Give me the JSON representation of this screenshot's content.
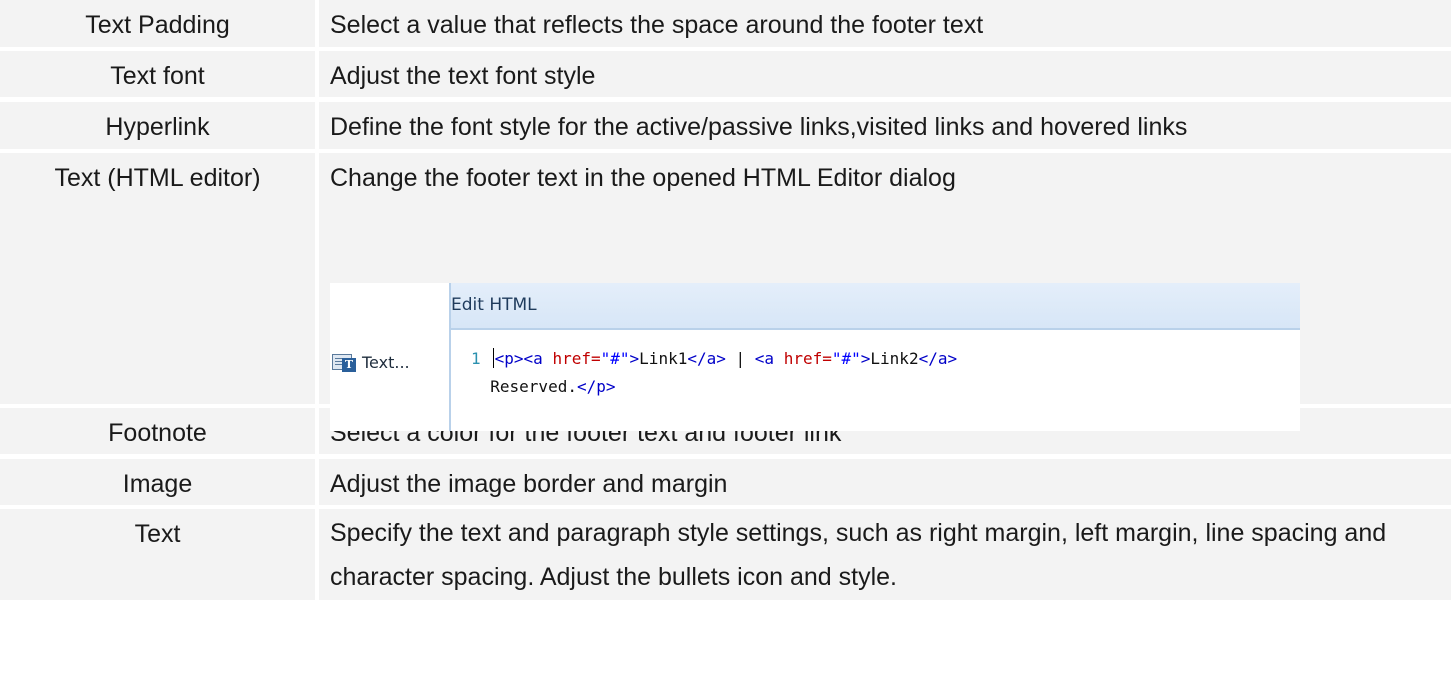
{
  "rows": [
    {
      "name": "Text Padding",
      "description": "Select a value that reflects the space around the footer text"
    },
    {
      "name": "Text font",
      "description": "Adjust the text font style"
    },
    {
      "name": "Hyperlink",
      "description": "Define the font style for the active/passive links,visited links and hovered links"
    },
    {
      "name": "Text (HTML editor)",
      "description": "Change the footer text in the opened HTML Editor dialog"
    },
    {
      "name": "Footnote",
      "description": "Select a color for the footer text and footer link"
    },
    {
      "name": "Image",
      "description": "Adjust the image border and margin"
    },
    {
      "name": "Text",
      "description": "Specify the text and paragraph style settings, such as right margin, left margin, line spacing and character spacing. Adjust the bullets icon and style."
    }
  ],
  "editor": {
    "tool_label": "Text...",
    "title": "Edit HTML",
    "line_number": "1",
    "code_line1": {
      "p_open": "<p>",
      "a1_open": "<a",
      "href_attr": "href=",
      "href_val": "\"#\"",
      "gt": ">",
      "link1": "Link1",
      "a_close": "</a>",
      "sep": " | ",
      "link2": "Link2"
    },
    "code_line2": {
      "text": "Reserved.",
      "p_close": "</p>"
    }
  }
}
